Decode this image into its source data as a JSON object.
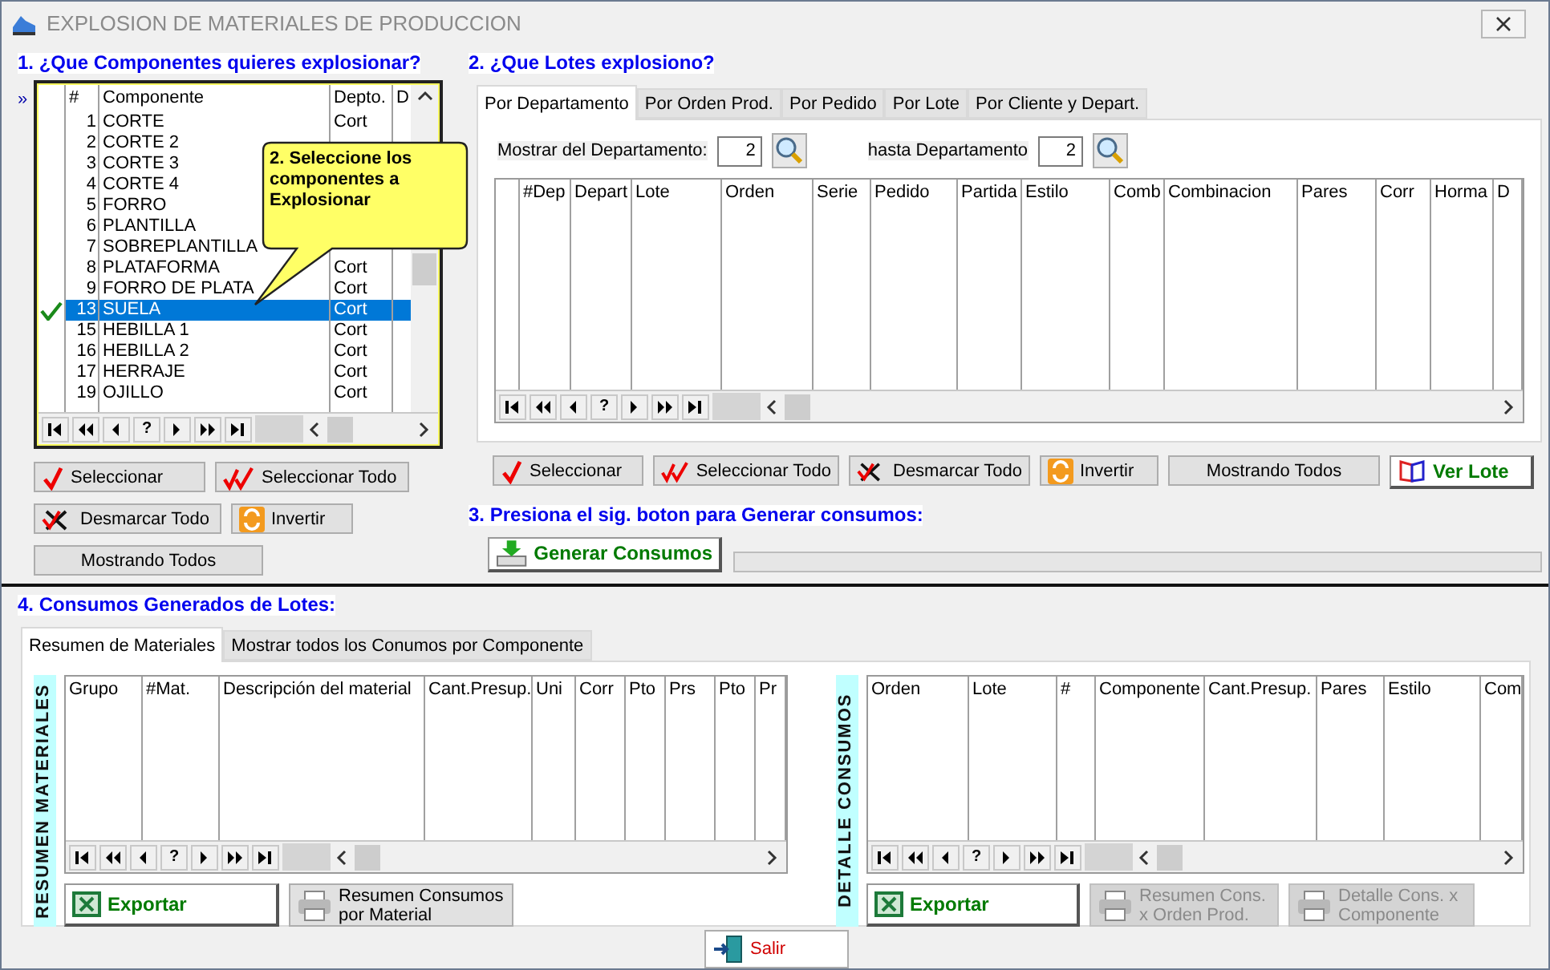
{
  "window": {
    "title": "EXPLOSION DE MATERIALES DE PRODUCCION"
  },
  "components": {
    "heading": "1. ¿Que Componentes quieres explosionar?",
    "indicator": "»",
    "columns": [
      "#",
      "Componente",
      "Depto.",
      "D"
    ],
    "rows": [
      {
        "num": "1",
        "name": "CORTE",
        "depto": "Cort",
        "checked": false,
        "selected": false
      },
      {
        "num": "2",
        "name": "CORTE 2",
        "checked": false,
        "selected": false
      },
      {
        "num": "3",
        "name": "CORTE 3",
        "checked": false,
        "selected": false
      },
      {
        "num": "4",
        "name": "CORTE 4",
        "checked": false,
        "selected": false
      },
      {
        "num": "5",
        "name": "FORRO",
        "checked": false,
        "selected": false
      },
      {
        "num": "6",
        "name": "PLANTILLA",
        "checked": false,
        "selected": false
      },
      {
        "num": "7",
        "name": "SOBREPLANTILLA",
        "checked": false,
        "selected": false
      },
      {
        "num": "8",
        "name": "PLATAFORMA",
        "depto": "Cort",
        "checked": false,
        "selected": false
      },
      {
        "num": "9",
        "name": "FORRO DE PLATA",
        "depto": "Cort",
        "checked": false,
        "selected": false
      },
      {
        "num": "13",
        "name": "SUELA",
        "depto": "Cort",
        "checked": true,
        "selected": true
      },
      {
        "num": "15",
        "name": "HEBILLA 1",
        "depto": "Cort",
        "checked": false,
        "selected": false
      },
      {
        "num": "16",
        "name": "HEBILLA 2",
        "depto": "Cort",
        "checked": false,
        "selected": false
      },
      {
        "num": "17",
        "name": "HERRAJE",
        "depto": "Cort",
        "checked": false,
        "selected": false
      },
      {
        "num": "19",
        "name": "OJILLO",
        "depto": "Cort",
        "checked": false,
        "selected": false
      }
    ],
    "navigator_help": "?",
    "callout": "2. Seleccione los componentes a Explosionar",
    "button_rows": [
      [
        {
          "label": "Seleccionar",
          "kind": "select"
        },
        {
          "label": "Seleccionar Todo",
          "kind": "select_all"
        }
      ],
      [
        {
          "label": "Desmarcar Todo",
          "kind": "unmark"
        },
        {
          "label": "Invertir",
          "kind": "invert"
        }
      ],
      [
        {
          "label": "Mostrando Todos",
          "kind": "plain"
        }
      ]
    ]
  },
  "lots": {
    "heading": "2. ¿Que Lotes explosiono?",
    "tabs": [
      {
        "label": "Por Departamento",
        "selected": true
      },
      {
        "label": "Por Orden Prod.",
        "selected": false
      },
      {
        "label": "Por Pedido",
        "selected": false
      },
      {
        "label": "Por Lote",
        "selected": false
      },
      {
        "label": "Por Cliente y Depart.",
        "selected": false
      }
    ],
    "from_label": "Mostrar del Departamento:",
    "from_value": "2",
    "to_label": "hasta Departamento",
    "to_value": "2",
    "columns": [
      "#Dep",
      "Depart",
      "Lote",
      "Orden",
      "Serie",
      "Pedido",
      "Partida",
      "Estilo",
      "Comb",
      "Combinacion",
      "Pares",
      "Corr",
      "Horma",
      "D"
    ],
    "navigator_help": "?",
    "buttons": [
      {
        "label": "Seleccionar",
        "kind": "select"
      },
      {
        "label": "Seleccionar Todo",
        "kind": "select_all"
      },
      {
        "label": "Desmarcar Todo",
        "kind": "unmark"
      },
      {
        "label": "Invertir",
        "kind": "invert"
      },
      {
        "label": "Mostrando Todos",
        "kind": "plain"
      },
      {
        "label": "Ver Lote",
        "kind": "view"
      }
    ]
  },
  "generate": {
    "heading": "3. Presiona el sig. boton para Generar consumos:",
    "button": "Generar Consumos",
    "progress": {
      "level": 0
    }
  },
  "consumption": {
    "heading": "4. Consumos Generados de Lotes:",
    "tabs": [
      {
        "label": "Resumen de Materiales",
        "selected": true
      },
      {
        "label": "Mostrar todos los Conumos por Componente",
        "selected": false
      }
    ],
    "summary": {
      "label": "RESUMEN MATERIALES",
      "columns": [
        "Grupo",
        "#Mat.",
        "Descripción del material",
        "Cant.Presup.",
        "Uni",
        "Corr",
        "Pto",
        "Prs",
        "Pto",
        "Pr"
      ],
      "navigator_help": "?",
      "buttons": [
        {
          "label": "Exportar",
          "kind": "export",
          "disabled": false
        },
        {
          "label": "Resumen Consumos por Material",
          "kind": "print",
          "disabled": false
        }
      ]
    },
    "detail": {
      "label": "DETALLE CONSUMOS",
      "columns": [
        "Orden",
        "Lote",
        "#",
        "Componente",
        "Cant.Presup.",
        "Pares",
        "Estilo",
        "Com"
      ],
      "navigator_help": "?",
      "buttons": [
        {
          "label": "Exportar",
          "kind": "export",
          "disabled": false
        },
        {
          "label": "Resumen Cons. x Orden Prod.",
          "kind": "print",
          "disabled": true
        },
        {
          "label": "Detalle Cons. x Componente",
          "kind": "print",
          "disabled": true
        }
      ]
    }
  },
  "exit_button": "Salir"
}
